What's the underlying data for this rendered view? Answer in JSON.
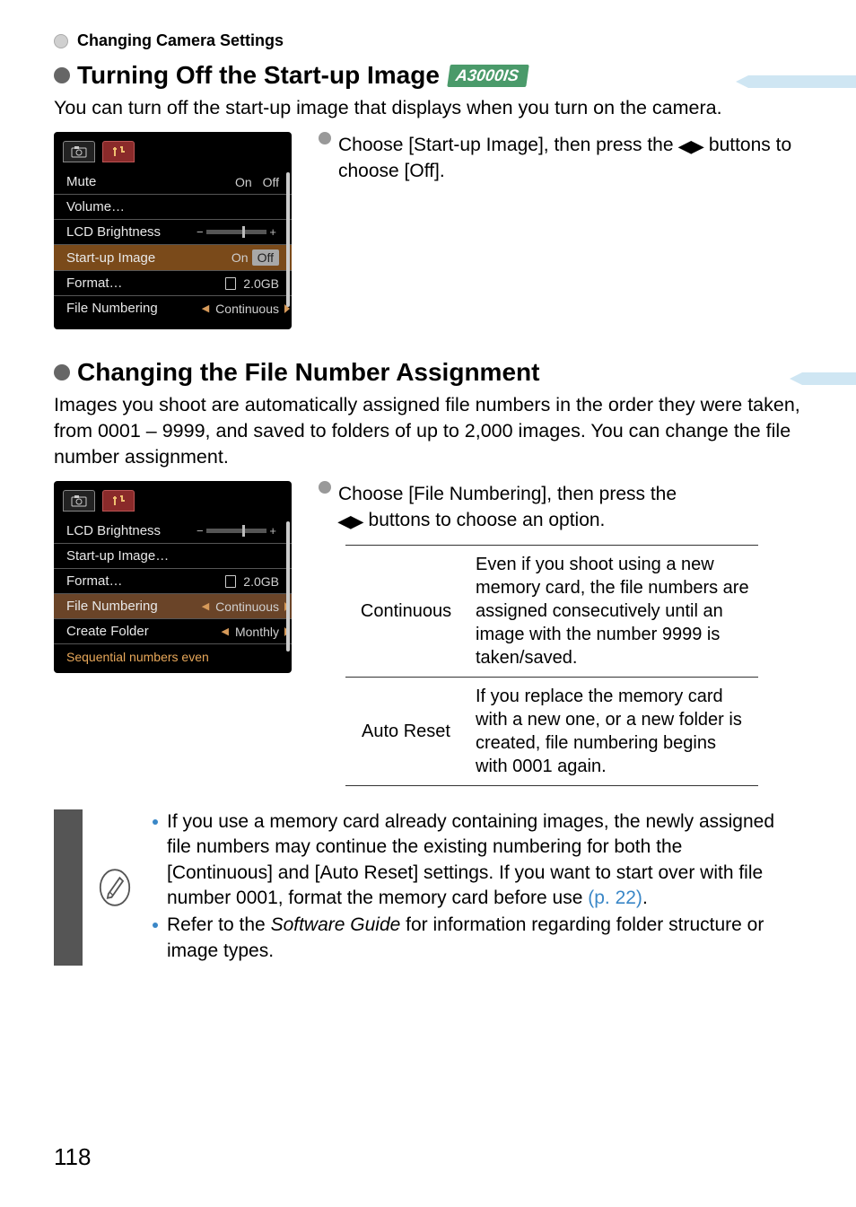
{
  "breadcrumb": "Changing Camera Settings",
  "section1": {
    "title": "Turning Off the Start-up Image",
    "badge": "A3000IS",
    "desc": "You can turn off the start-up image that displays when you turn on the camera.",
    "step_a": "Choose [Start-up Image], then press the ",
    "step_b": " buttons to choose [Off]."
  },
  "lcd1": {
    "rows": {
      "mute_label": "Mute",
      "mute_on": "On",
      "mute_off": "Off",
      "volume_label": "Volume…",
      "lcd_label": "LCD Brightness",
      "startup_label": "Start-up Image",
      "startup_on": "On",
      "startup_off": "Off",
      "format_label": "Format…",
      "format_val": "2.0GB",
      "filenum_label": "File Numbering",
      "filenum_val": "Continuous"
    }
  },
  "section2": {
    "title": "Changing the File Number Assignment",
    "desc": "Images you shoot are automatically assigned file numbers in the order they were taken, from 0001 – 9999, and saved to folders of up to 2,000 images. You can change the file number assignment.",
    "step_a": "Choose [File Numbering], then press the ",
    "step_b": " buttons to choose an option."
  },
  "lcd2": {
    "rows": {
      "lcd_label": "LCD Brightness",
      "startup_label": "Start-up Image…",
      "format_label": "Format…",
      "format_val": "2.0GB",
      "filenum_label": "File Numbering",
      "filenum_val": "Continuous",
      "create_label": "Create Folder",
      "create_val": "Monthly"
    },
    "footer": "Sequential numbers even"
  },
  "table": {
    "r1k": "Continuous",
    "r1v": "Even if you shoot using a new memory card, the file numbers are assigned consecutively until an image with the number 9999 is taken/saved.",
    "r2k": "Auto Reset",
    "r2v": "If you replace the memory card with a new one, or a new folder is created, file numbering begins with 0001 again."
  },
  "note": {
    "b1a": "If you use a memory card already containing images, the newly assigned file numbers may continue the existing numbering for both the [Continuous] and [Auto Reset] settings. If you want to start over with file number 0001, format the memory card before use ",
    "b1link": "(p. 22)",
    "b1end": ".",
    "b2a": "Refer to the ",
    "b2i": "Software Guide",
    "b2b": " for information regarding folder structure or image types."
  },
  "pagenum": "118"
}
